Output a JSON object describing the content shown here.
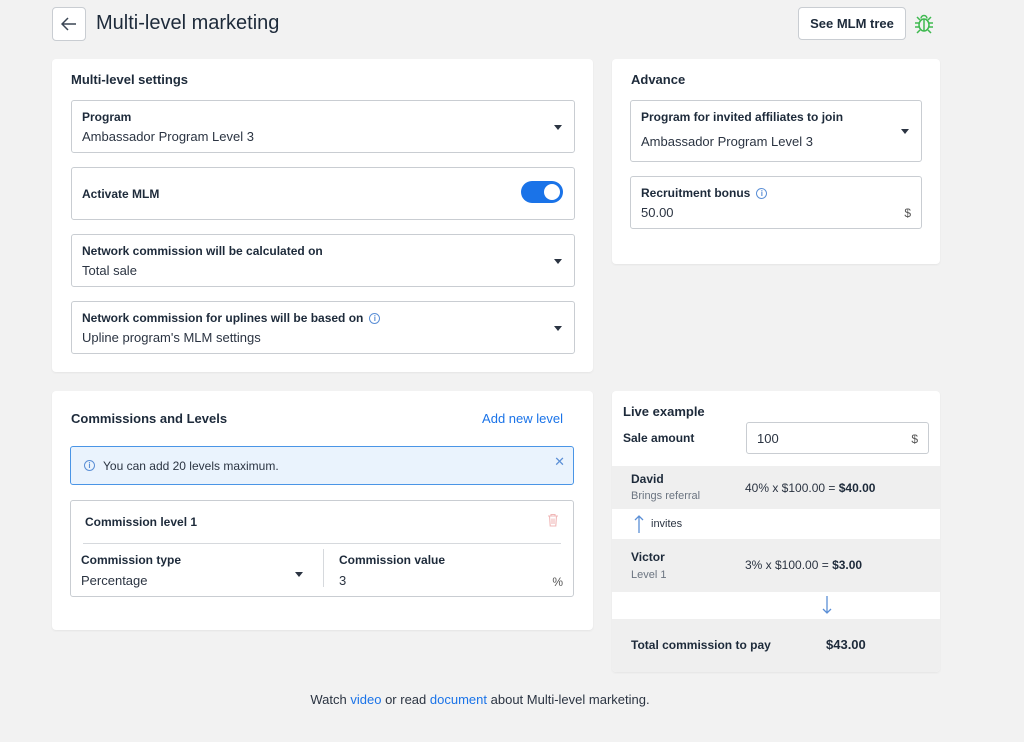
{
  "header": {
    "title": "Multi-level marketing",
    "tree_button": "See MLM tree"
  },
  "settings": {
    "title": "Multi-level settings",
    "program_label": "Program",
    "program_value": "Ambassador Program Level 3",
    "activate_label": "Activate MLM",
    "activate_on": true,
    "calc_label": "Network commission will be calculated on",
    "calc_value": "Total sale",
    "uplines_label": "Network commission for uplines will be based on",
    "uplines_value": "Upline program's MLM settings"
  },
  "advance": {
    "title": "Advance",
    "invited_label": "Program for invited affiliates to join",
    "invited_value": "Ambassador Program Level 3",
    "bonus_label": "Recruitment bonus",
    "bonus_value": "50.00",
    "bonus_suffix": "$"
  },
  "commissions": {
    "title": "Commissions and Levels",
    "add_level": "Add new level",
    "alert": "You can add 20 levels maximum.",
    "level_title": "Commission level 1",
    "type_label": "Commission type",
    "type_value": "Percentage",
    "value_label": "Commission value",
    "value_value": "3",
    "value_suffix": "%"
  },
  "live": {
    "title": "Live example",
    "sale_label": "Sale amount",
    "sale_value": "100",
    "sale_suffix": "$",
    "row1_name": "David",
    "row1_sub": "Brings referral",
    "row1_calc": "40% x $100.00 = ",
    "row1_result": "$40.00",
    "invites": "invites",
    "row2_name": "Victor",
    "row2_sub": "Level 1",
    "row2_calc": "3% x $100.00 = ",
    "row2_result": "$3.00",
    "total_label": "Total commission to pay",
    "total_value": "$43.00"
  },
  "footer": {
    "watch": "Watch",
    "video": "video",
    "or_read": "or read",
    "document": "document",
    "about": "about Multi-level marketing."
  },
  "colors": {
    "accent": "#1a73e8",
    "bug": "#3fb950"
  }
}
